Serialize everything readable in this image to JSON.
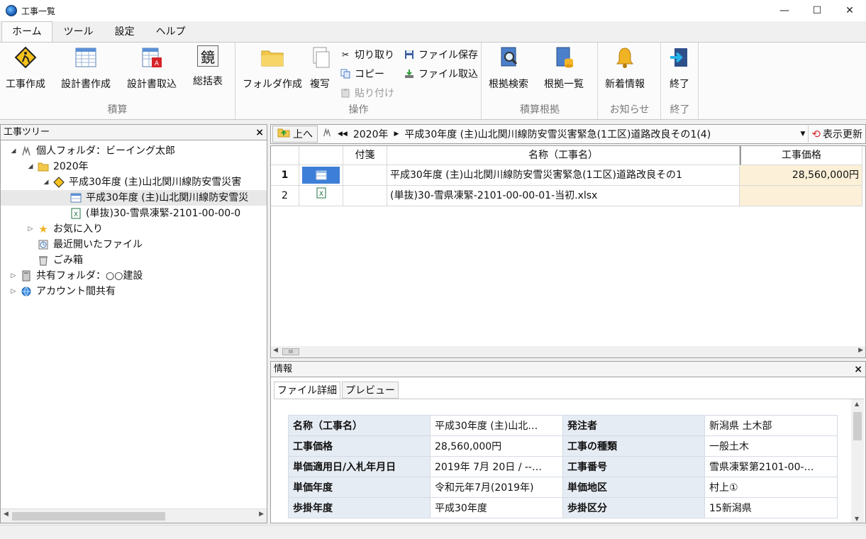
{
  "window": {
    "title": "工事一覧",
    "minimize": "—",
    "maximize": "☐",
    "close": "✕"
  },
  "ribbon_tabs": [
    "ホーム",
    "ツール",
    "設定",
    "ヘルプ"
  ],
  "ribbon": {
    "groups": {
      "sekisan": "積算",
      "sousa": "操作",
      "sekisan_konkyo": "積算根拠",
      "oshirase": "お知らせ",
      "shuryo": "終了"
    },
    "buttons": {
      "koji_sakusei": "工事作成",
      "sekkeisho_sakusei": "設計書作成",
      "sekkeisho_torikomi": "設計書取込",
      "soukatsu": "総括表",
      "folder_sakusei": "フォルダ作成",
      "fukusha": "複写",
      "kiritori": "切り取り",
      "copy": "コピー",
      "haritsuke": "貼り付け",
      "file_hozon": "ファイル保存",
      "file_torikomi": "ファイル取込",
      "konkyo_kensaku": "根拠検索",
      "konkyo_ichiran": "根拠一覧",
      "shinchaku": "新着情報",
      "shuryo": "終了"
    },
    "soukatsu_glyph": "鏡"
  },
  "left_panel": {
    "title": "工事ツリー",
    "close": "×",
    "tree": [
      {
        "label": "個人フォルダ：ビーイング太郎"
      },
      {
        "label": "2020年"
      },
      {
        "label": "平成30年度 (主)山北関川線防安雪災害"
      },
      {
        "label": "平成30年度 (主)山北関川線防安雪災"
      },
      {
        "label": "(単抜)30-雪県凍緊-2101-00-00-0"
      },
      {
        "label": "お気に入り"
      },
      {
        "label": "最近開いたファイル"
      },
      {
        "label": "ごみ箱"
      },
      {
        "label": "共有フォルダ：○○建設"
      },
      {
        "label": "アカウント間共有"
      }
    ]
  },
  "navbar": {
    "up": "上へ",
    "path_year": "2020年",
    "path_project": "平成30年度 (主)山北関川線防安雪災害緊急(1工区)道路改良その1(4)",
    "refresh": "表示更新"
  },
  "grid": {
    "headers": {
      "tag": "付箋",
      "name": "名称（工事名）",
      "price": "工事価格"
    },
    "rows": [
      {
        "num": "1",
        "name": "平成30年度 (主)山北関川線防安雪災害緊急(1工区)道路改良その1",
        "price": "28,560,000円"
      },
      {
        "num": "2",
        "name": "(単抜)30-雪県凍緊-2101-00-00-01-当初.xlsx",
        "price": ""
      }
    ],
    "scroll_thumb": "III"
  },
  "info_panel": {
    "title": "情報",
    "close": "×",
    "tabs": [
      "ファイル詳細",
      "プレビュー"
    ],
    "rows": [
      {
        "k1": "名称（工事名）",
        "v1": "平成30年度 (主)山北…",
        "k2": "発注者",
        "v2": "新潟県 土木部"
      },
      {
        "k1": "工事価格",
        "v1": "28,560,000円",
        "k2": "工事の種類",
        "v2": "一般土木"
      },
      {
        "k1": "単価適用日/入札年月日",
        "v1": "2019年 7月 20日 / --…",
        "k2": "工事番号",
        "v2": "雪県凍緊第2101-00-…"
      },
      {
        "k1": "単価年度",
        "v1": "令和元年7月(2019年)",
        "k2": "単価地区",
        "v2": "村上①"
      },
      {
        "k1": "歩掛年度",
        "v1": "平成30年度",
        "k2": "歩掛区分",
        "v2": "15新潟県"
      }
    ]
  },
  "colors": {
    "accent_selection": "#3d7fd8",
    "price_column": "#fcf0d8",
    "info_key_bg": "#e6ecf3"
  }
}
